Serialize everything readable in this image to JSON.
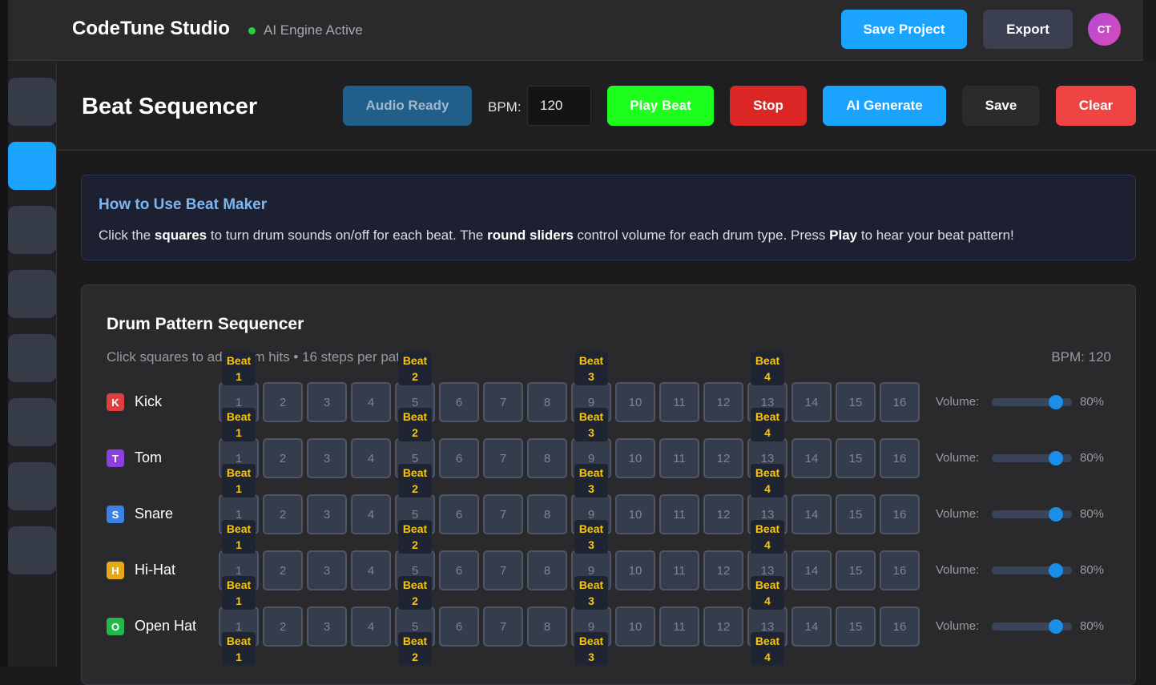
{
  "header": {
    "app_name": "CodeTune Studio",
    "engine_status": "AI Engine Active",
    "save_project_label": "Save Project",
    "export_label": "Export",
    "avatar_initials": "CT"
  },
  "sidebar": {
    "items": [
      {
        "name": "sidebar-item-1",
        "active": false
      },
      {
        "name": "sidebar-item-2",
        "active": true
      },
      {
        "name": "sidebar-item-3",
        "active": false
      },
      {
        "name": "sidebar-item-4",
        "active": false
      },
      {
        "name": "sidebar-item-5",
        "active": false
      },
      {
        "name": "sidebar-item-6",
        "active": false
      },
      {
        "name": "sidebar-item-7",
        "active": false
      },
      {
        "name": "sidebar-item-8",
        "active": false
      }
    ]
  },
  "toolbar": {
    "title": "Beat Sequencer",
    "audio_ready_label": "Audio Ready",
    "bpm_label": "BPM:",
    "bpm_value": "120",
    "play_label": "Play Beat",
    "stop_label": "Stop",
    "ai_generate_label": "AI Generate",
    "save_label": "Save",
    "clear_label": "Clear"
  },
  "info": {
    "title": "How to Use Beat Maker",
    "text_1": "Click the ",
    "bold_1": "squares",
    "text_2": " to turn drum sounds on/off for each beat. The ",
    "bold_2": "round sliders",
    "text_3": " control volume for each drum type. Press ",
    "bold_3": "Play",
    "text_4": " to hear your beat pattern!"
  },
  "sequencer": {
    "title": "Drum Pattern Sequencer",
    "subtitle": "Click squares to add drum hits • 16 steps per pattern",
    "bpm_display": "BPM: 120",
    "volume_label": "Volume:",
    "beat_word": "Beat",
    "beat_markers": [
      "1",
      "2",
      "3",
      "4"
    ],
    "steps": [
      "1",
      "2",
      "3",
      "4",
      "5",
      "6",
      "7",
      "8",
      "9",
      "10",
      "11",
      "12",
      "13",
      "14",
      "15",
      "16"
    ],
    "tracks": [
      {
        "name": "Kick",
        "initial": "K",
        "color": "#e03e3e",
        "volume": 80,
        "volume_text": "80%"
      },
      {
        "name": "Tom",
        "initial": "T",
        "color": "#8b3fe0",
        "volume": 80,
        "volume_text": "80%"
      },
      {
        "name": "Snare",
        "initial": "S",
        "color": "#3b82e6",
        "volume": 80,
        "volume_text": "80%"
      },
      {
        "name": "Hi-Hat",
        "initial": "H",
        "color": "#e6a817",
        "volume": 80,
        "volume_text": "80%"
      },
      {
        "name": "Open Hat",
        "initial": "O",
        "color": "#22b84c",
        "volume": 80,
        "volume_text": "80%"
      }
    ]
  }
}
